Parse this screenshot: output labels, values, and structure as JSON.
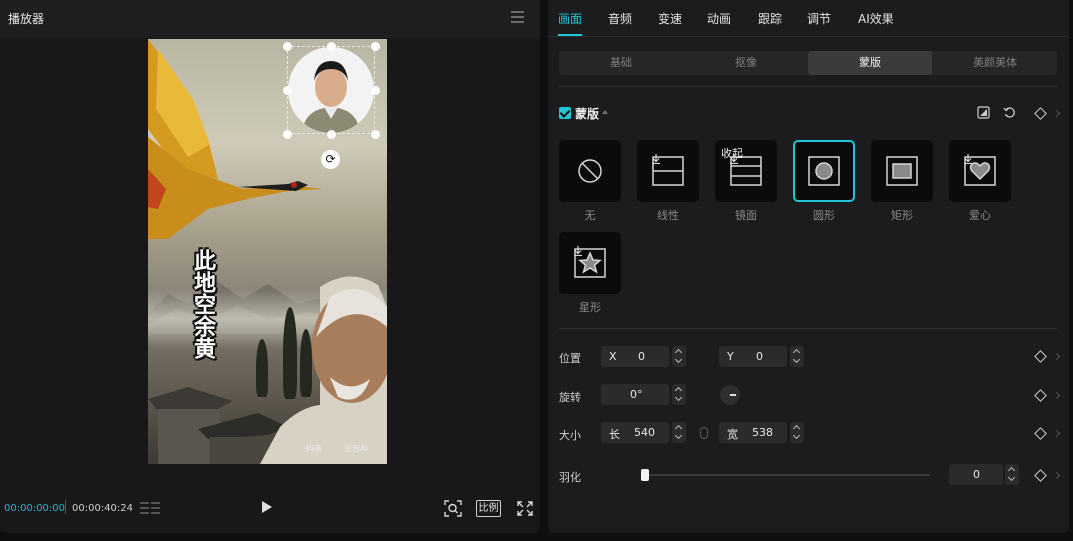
{
  "player": {
    "title": "播放器",
    "preview": {
      "vertical_text": "此地空余黄",
      "watermark_left": "抖音",
      "watermark_right": "豆包AI"
    },
    "controls": {
      "current_time": "00:00:00:00",
      "total_time": "00:00:40:24",
      "ratio_label": "比例"
    }
  },
  "inspector": {
    "main_tabs": [
      "画面",
      "音频",
      "变速",
      "动画",
      "跟踪",
      "调节",
      "AI效果"
    ],
    "active_main_tab": "画面",
    "sub_tabs": [
      "基础",
      "抠像",
      "蒙版",
      "美颜美体"
    ],
    "active_sub_tab": "蒙版",
    "section": {
      "title": "蒙版",
      "enabled": true
    },
    "masks": [
      {
        "label": "无",
        "icon": "none-icon"
      },
      {
        "label": "线性",
        "icon": "linear-mask-icon"
      },
      {
        "label": "镜面",
        "icon": "mirror-mask-icon",
        "tooltip": "收起"
      },
      {
        "label": "圆形",
        "icon": "circle-mask-icon",
        "selected": true
      },
      {
        "label": "矩形",
        "icon": "rectangle-mask-icon"
      },
      {
        "label": "爱心",
        "icon": "heart-mask-icon"
      },
      {
        "label": "星形",
        "icon": "star-mask-icon"
      }
    ],
    "position": {
      "label": "位置",
      "x_label": "X",
      "x": "0",
      "y_label": "Y",
      "y": "0"
    },
    "rotation": {
      "label": "旋转",
      "value": "0°"
    },
    "size": {
      "label": "大小",
      "length_label": "长",
      "length": "540",
      "width_label": "宽",
      "width": "538"
    },
    "feather": {
      "label": "羽化",
      "value": "0",
      "level": 0
    }
  },
  "colors": {
    "accent": "#22c5d6",
    "panel_bg": "#1c1c1e",
    "player_bg": "#18181a"
  }
}
